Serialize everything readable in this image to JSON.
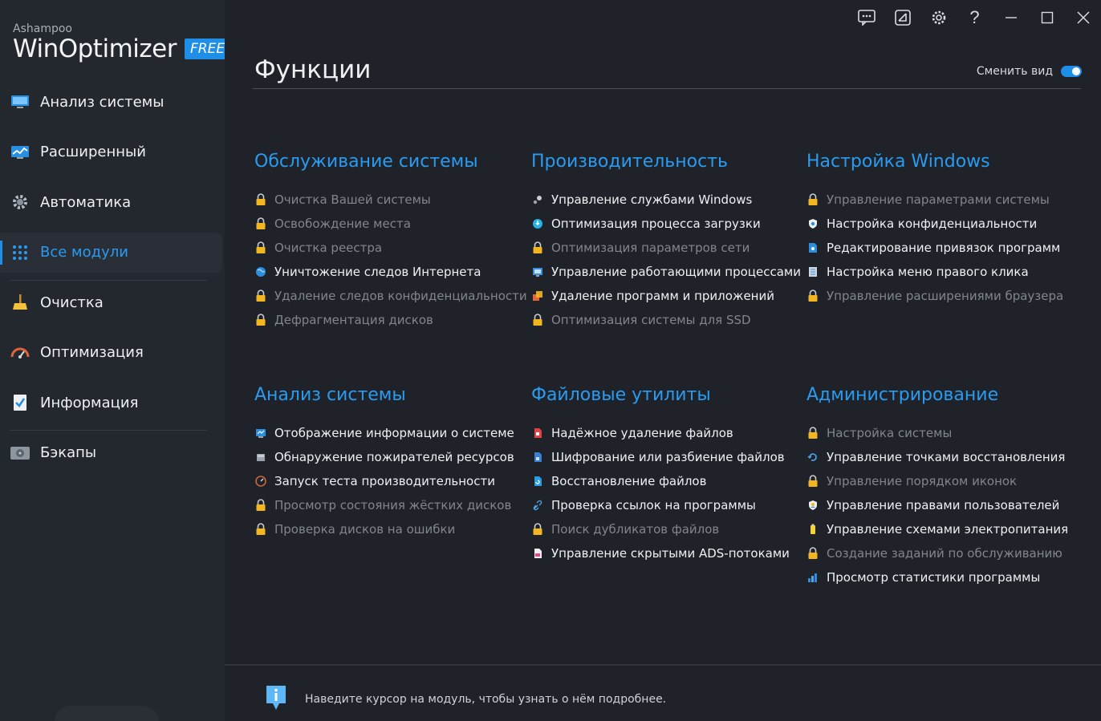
{
  "app": {
    "vendor": "Ashampoo",
    "name": "WinOptimizer",
    "badge": "FREE"
  },
  "titlebar": {
    "buttons": [
      {
        "name": "feedback-icon",
        "glyph": "💬"
      },
      {
        "name": "skin-icon",
        "glyph": "◪"
      },
      {
        "name": "settings-icon",
        "glyph": "⚙"
      },
      {
        "name": "help-icon",
        "glyph": "?"
      },
      {
        "name": "minimize-icon",
        "glyph": "—"
      },
      {
        "name": "maximize-icon",
        "glyph": "☐"
      },
      {
        "name": "close-icon",
        "glyph": "✕"
      }
    ]
  },
  "sidebar": {
    "items": [
      {
        "label": "Анализ системы",
        "icon": "monitor-icon"
      },
      {
        "label": "Расширенный",
        "icon": "chart-icon"
      },
      {
        "label": "Автоматика",
        "icon": "gear-icon"
      },
      {
        "label": "Все модули",
        "icon": "grid-icon",
        "active": true
      },
      {
        "label": "Очистка",
        "icon": "broom-icon"
      },
      {
        "label": "Оптимизация",
        "icon": "speedometer-icon"
      },
      {
        "label": "Информация",
        "icon": "checklist-icon"
      },
      {
        "label": "Бэкапы",
        "icon": "disk-icon"
      }
    ]
  },
  "main": {
    "title": "Функции",
    "view_toggle_label": "Сменить вид",
    "hint": "Наведите курсор на модуль, чтобы узнать о нём подробнее."
  },
  "sections": [
    {
      "title": "Обслуживание системы",
      "items": [
        {
          "label": "Очистка Вашей системы",
          "locked": true
        },
        {
          "label": "Освобождение места",
          "locked": true
        },
        {
          "label": "Очистка реестра",
          "locked": true
        },
        {
          "label": "Уничтожение следов Интернета",
          "locked": false,
          "icon": "globe-icon"
        },
        {
          "label": "Удаление следов конфиденциальности",
          "locked": true
        },
        {
          "label": "Дефрагментация дисков",
          "locked": true
        }
      ]
    },
    {
      "title": "Производительность",
      "items": [
        {
          "label": "Управление службами Windows",
          "locked": false,
          "icon": "services-icon"
        },
        {
          "label": "Оптимизация процесса загрузки",
          "locked": false,
          "icon": "boot-icon"
        },
        {
          "label": "Оптимизация параметров сети",
          "locked": true
        },
        {
          "label": "Управление работающими процессами",
          "locked": false,
          "icon": "process-icon"
        },
        {
          "label": "Удаление программ и приложений",
          "locked": false,
          "icon": "uninstall-icon"
        },
        {
          "label": "Оптимизация системы для SSD",
          "locked": true
        }
      ]
    },
    {
      "title": "Настройка Windows",
      "items": [
        {
          "label": "Управление параметрами системы",
          "locked": true
        },
        {
          "label": "Настройка конфиденциальности",
          "locked": false,
          "icon": "shield-icon"
        },
        {
          "label": "Редактирование привязок программ",
          "locked": false,
          "icon": "file-association-icon"
        },
        {
          "label": "Настройка меню правого клика",
          "locked": false,
          "icon": "context-menu-icon"
        },
        {
          "label": "Управление расширениями браузера",
          "locked": true
        }
      ]
    },
    {
      "title": "Анализ системы",
      "items": [
        {
          "label": "Отображение информации о системе",
          "locked": false,
          "icon": "system-info-icon"
        },
        {
          "label": "Обнаружение пожирателей ресурсов",
          "locked": false,
          "icon": "resource-icon"
        },
        {
          "label": "Запуск теста производительности",
          "locked": false,
          "icon": "benchmark-icon"
        },
        {
          "label": "Просмотр состояния жёстких дисков",
          "locked": true
        },
        {
          "label": "Проверка дисков на ошибки",
          "locked": true
        }
      ]
    },
    {
      "title": "Файловые утилиты",
      "items": [
        {
          "label": "Надёжное удаление файлов",
          "locked": false,
          "icon": "file-wiper-icon"
        },
        {
          "label": "Шифрование или разбиение файлов",
          "locked": false,
          "icon": "file-encrypt-icon"
        },
        {
          "label": "Восстановление файлов",
          "locked": false,
          "icon": "file-restore-icon"
        },
        {
          "label": "Проверка ссылок на программы",
          "locked": false,
          "icon": "link-icon"
        },
        {
          "label": "Поиск дубликатов файлов",
          "locked": true
        },
        {
          "label": "Управление скрытыми ADS-потоками",
          "locked": false,
          "icon": "ads-icon"
        }
      ]
    },
    {
      "title": "Администрирование",
      "items": [
        {
          "label": "Настройка системы",
          "locked": true
        },
        {
          "label": "Управление точками восстановления",
          "locked": false,
          "icon": "restore-point-icon"
        },
        {
          "label": "Управление порядком иконок",
          "locked": true
        },
        {
          "label": "Управление правами пользователей",
          "locked": false,
          "icon": "user-rights-icon"
        },
        {
          "label": "Управление схемами электропитания",
          "locked": false,
          "icon": "power-icon"
        },
        {
          "label": "Создание заданий по обслуживанию",
          "locked": true
        },
        {
          "label": "Просмотр статистики программы",
          "locked": false,
          "icon": "statistics-icon"
        }
      ]
    }
  ],
  "colors": {
    "accent": "#2a9bf0",
    "lock": "#f2b620",
    "background": "#1f2329",
    "sidebar": "#23272e"
  }
}
